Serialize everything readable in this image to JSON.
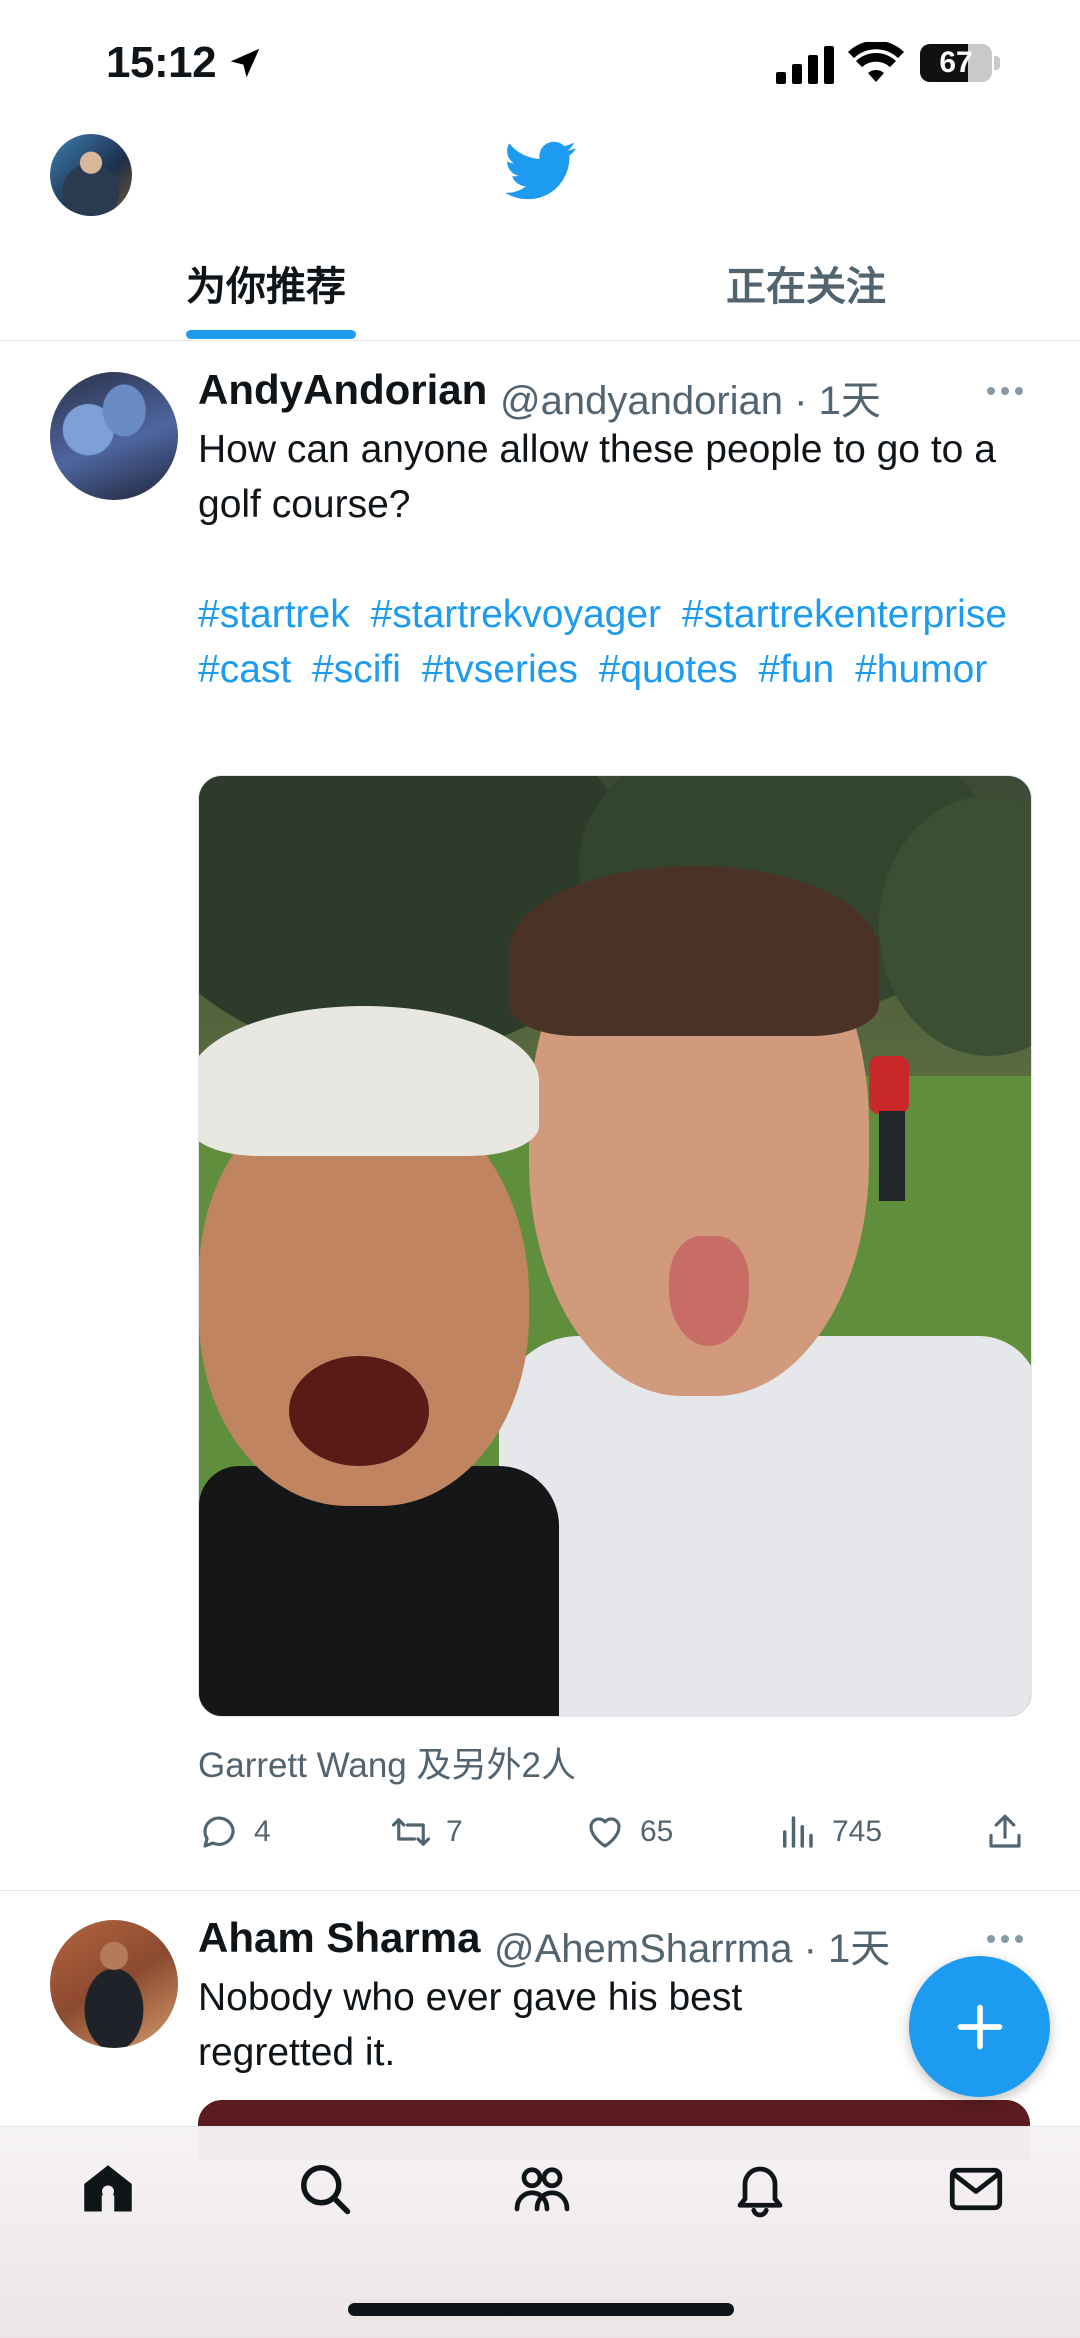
{
  "status_bar": {
    "time": "15:12",
    "battery_level": "67",
    "battery_fraction": 0.67
  },
  "header": {
    "logo_icon": "twitter-bird-icon",
    "avatar_icon": "profile-avatar",
    "tabs": [
      {
        "label": "为你推荐",
        "active": true
      },
      {
        "label": "正在关注",
        "active": false
      }
    ]
  },
  "tweets": [
    {
      "author_name": "AndyAndorian",
      "meta": "@andyandorian · 1天",
      "text": "How can anyone allow these people to go to a golf course?",
      "hashtags": [
        "#startrek",
        "#startrekvoyager",
        "#startrekenterprise",
        "#cast",
        "#scifi",
        "#tvseries",
        "#quotes",
        "#fun",
        "#humor"
      ],
      "liked_by": "Garrett Wang 及另外2人",
      "replies": "4",
      "retweets": "7",
      "likes": "65",
      "views": "745"
    },
    {
      "author_name": "Aham Sharma",
      "meta": "@AhemSharrma · 1天",
      "text": "Nobody who ever gave his best regretted it."
    }
  ],
  "fab_icon": "plus-icon",
  "bottom_nav": [
    "home-icon",
    "search-icon",
    "communities-icon",
    "notifications-icon",
    "messages-icon"
  ],
  "colors": {
    "accent": "#1d9bf0",
    "text_primary": "#0f1419",
    "text_secondary": "#536471"
  }
}
